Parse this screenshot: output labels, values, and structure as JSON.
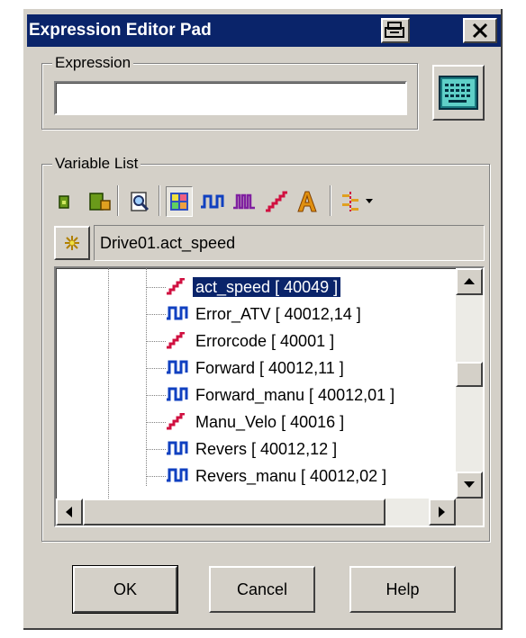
{
  "window": {
    "title": "Expression Editor Pad"
  },
  "expression": {
    "legend": "Expression",
    "value": ""
  },
  "variables": {
    "legend": "Variable List",
    "path_value": "Drive01.act_speed",
    "items": [
      {
        "label": "act_speed [ 40049 ]",
        "icon": "analog-icon",
        "selected": true
      },
      {
        "label": "Error_ATV [ 40012,14 ]",
        "icon": "digital-icon",
        "selected": false
      },
      {
        "label": "Errorcode [ 40001 ]",
        "icon": "analog-icon",
        "selected": false
      },
      {
        "label": "Forward [ 40012,11 ]",
        "icon": "digital-icon",
        "selected": false
      },
      {
        "label": "Forward_manu [ 40012,01 ]",
        "icon": "digital-icon",
        "selected": false
      },
      {
        "label": "Manu_Velo [ 40016 ]",
        "icon": "analog-icon",
        "selected": false
      },
      {
        "label": "Revers [ 40012,12 ]",
        "icon": "digital-icon",
        "selected": false
      },
      {
        "label": "Revers_manu [ 40012,02 ]",
        "icon": "digital-icon",
        "selected": false
      }
    ]
  },
  "buttons": {
    "ok": "OK",
    "cancel": "Cancel",
    "help": "Help"
  },
  "colors": {
    "titlebar": "#0a246a",
    "face": "#d4d0c8",
    "analog": "#d01040",
    "digital": "#1040c0"
  }
}
